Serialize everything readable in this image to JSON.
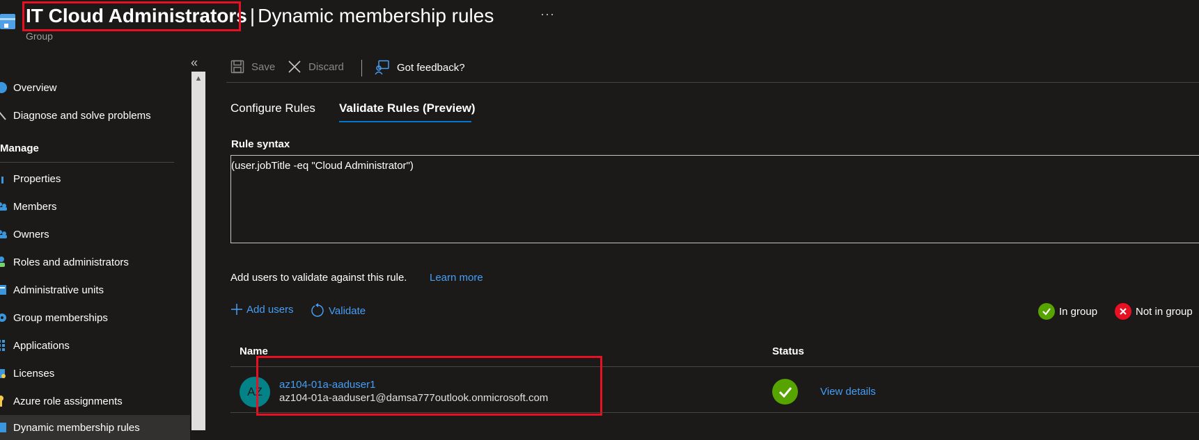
{
  "header": {
    "title_strong": "IT Cloud Administrators",
    "separator": "|",
    "title_rest": "Dynamic membership rules",
    "more": "···",
    "subtitle": "Group"
  },
  "sidebar": {
    "collapse": "«",
    "items": [
      {
        "label": "Overview",
        "icon": "info-icon"
      },
      {
        "label": "Diagnose and solve problems",
        "icon": "wrench-icon"
      }
    ],
    "manage_heading": "Manage",
    "manage_items": [
      {
        "label": "Properties",
        "icon": "properties-icon"
      },
      {
        "label": "Members",
        "icon": "members-icon"
      },
      {
        "label": "Owners",
        "icon": "owners-icon"
      },
      {
        "label": "Roles and administrators",
        "icon": "roles-icon"
      },
      {
        "label": "Administrative units",
        "icon": "admin-units-icon"
      },
      {
        "label": "Group memberships",
        "icon": "gear-icon"
      },
      {
        "label": "Applications",
        "icon": "grid-icon"
      },
      {
        "label": "Licenses",
        "icon": "license-icon"
      },
      {
        "label": "Azure role assignments",
        "icon": "key-icon"
      },
      {
        "label": "Dynamic membership rules",
        "icon": "rules-icon",
        "selected": true
      }
    ]
  },
  "toolbar": {
    "save_label": "Save",
    "discard_label": "Discard",
    "feedback_label": "Got feedback?"
  },
  "tabs": [
    {
      "label": "Configure Rules",
      "selected": false
    },
    {
      "label": "Validate Rules (Preview)",
      "selected": true
    }
  ],
  "rule": {
    "label": "Rule syntax",
    "value": "(user.jobTitle -eq \"Cloud Administrator\")"
  },
  "validate": {
    "description": "Add users to validate against this rule.",
    "learn_more": "Learn more",
    "add_users": "Add users",
    "validate": "Validate",
    "legend_in": "In group",
    "legend_out": "Not in group"
  },
  "table": {
    "columns": [
      "Name",
      "Status"
    ],
    "rows": [
      {
        "avatar": "AZ",
        "name": "az104-01a-aaduser1",
        "email": "az104-01a-aaduser1@damsa777outlook.onmicrosoft.com",
        "status": "in-group",
        "details_link": "View details"
      }
    ]
  },
  "colors": {
    "accent": "#0078d4",
    "link": "#479ef5",
    "success": "#57a300",
    "error": "#e81123",
    "annotation": "#e81123"
  }
}
